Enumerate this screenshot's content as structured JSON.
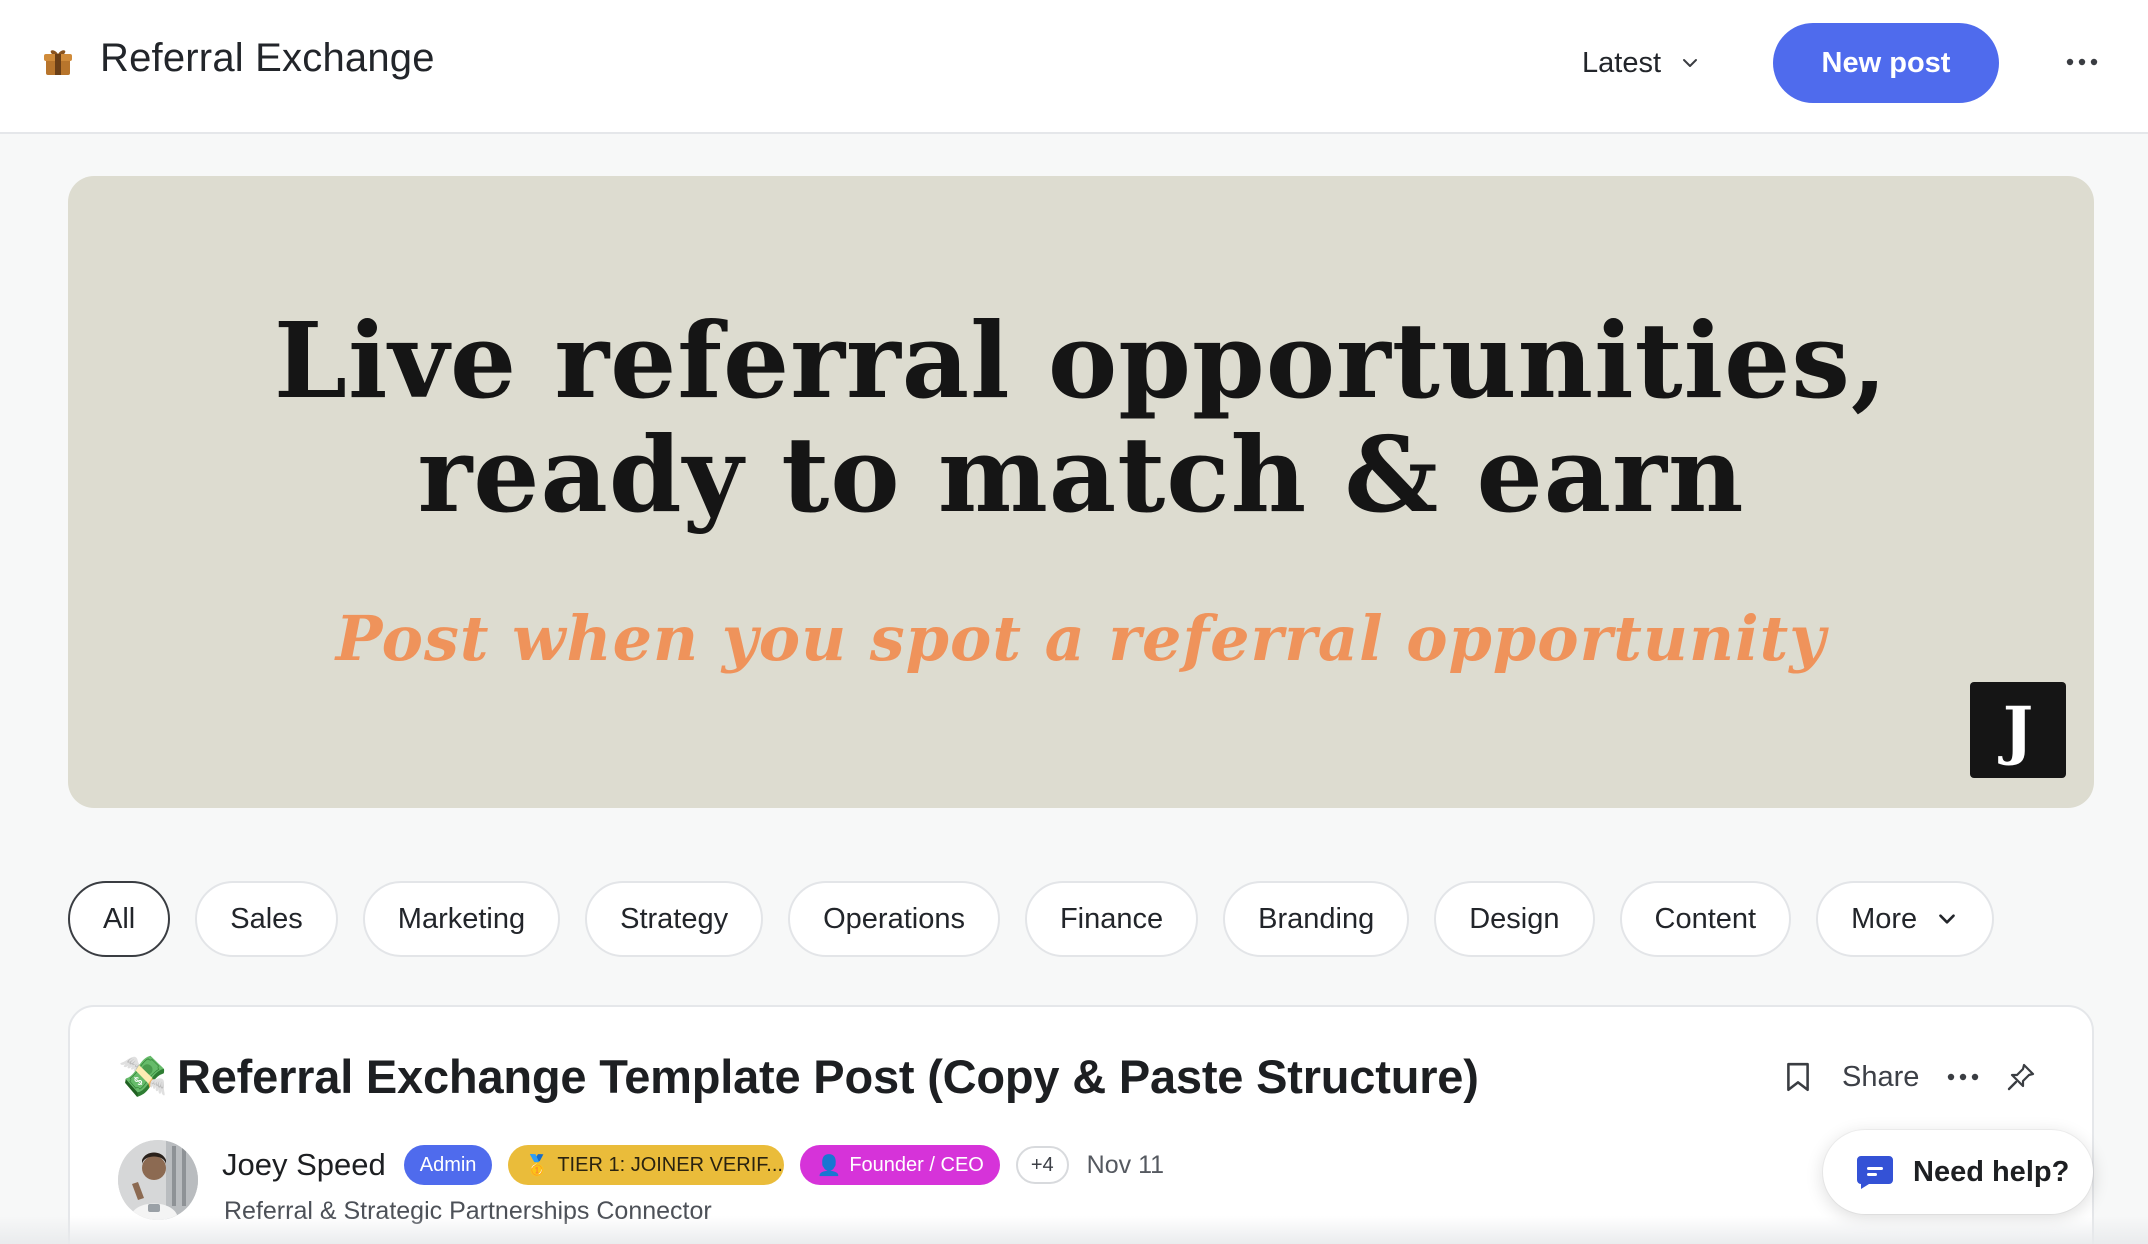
{
  "header": {
    "brand_icon": "gift-box-icon",
    "title": "Referral Exchange",
    "sort_label": "Latest",
    "new_post_label": "New post",
    "more_icon": "ellipsis-icon"
  },
  "banner": {
    "headline_line1": "Live referral opportunities,",
    "headline_line2": "ready to match & earn",
    "subheadline": "Post when you spot a referral opportunity",
    "logo_letter": "J",
    "background_color": "#dddcd0",
    "subheadline_color": "#ef935b"
  },
  "categories": {
    "items": [
      "All",
      "Sales",
      "Marketing",
      "Strategy",
      "Operations",
      "Finance",
      "Branding",
      "Design",
      "Content"
    ],
    "selected": "All",
    "more_label": "More"
  },
  "post": {
    "emoji": "💸",
    "title": "Referral Exchange Template Post (Copy & Paste Structure)",
    "share_label": "Share",
    "author": {
      "name": "Joey Speed",
      "role": "Referral & Strategic Partnerships Connector",
      "badges": {
        "admin": "Admin",
        "tier": "TIER 1: JOINER VERIF...",
        "tier_emoji": "🥇",
        "founder": "Founder / CEO",
        "founder_emoji": "👤",
        "more": "+4"
      }
    },
    "date": "Nov 11"
  },
  "help": {
    "label": "Need help?"
  },
  "colors": {
    "accent": "#4f6bed",
    "tier_badge": "#eabc3a",
    "founder_badge": "#d633d9"
  }
}
